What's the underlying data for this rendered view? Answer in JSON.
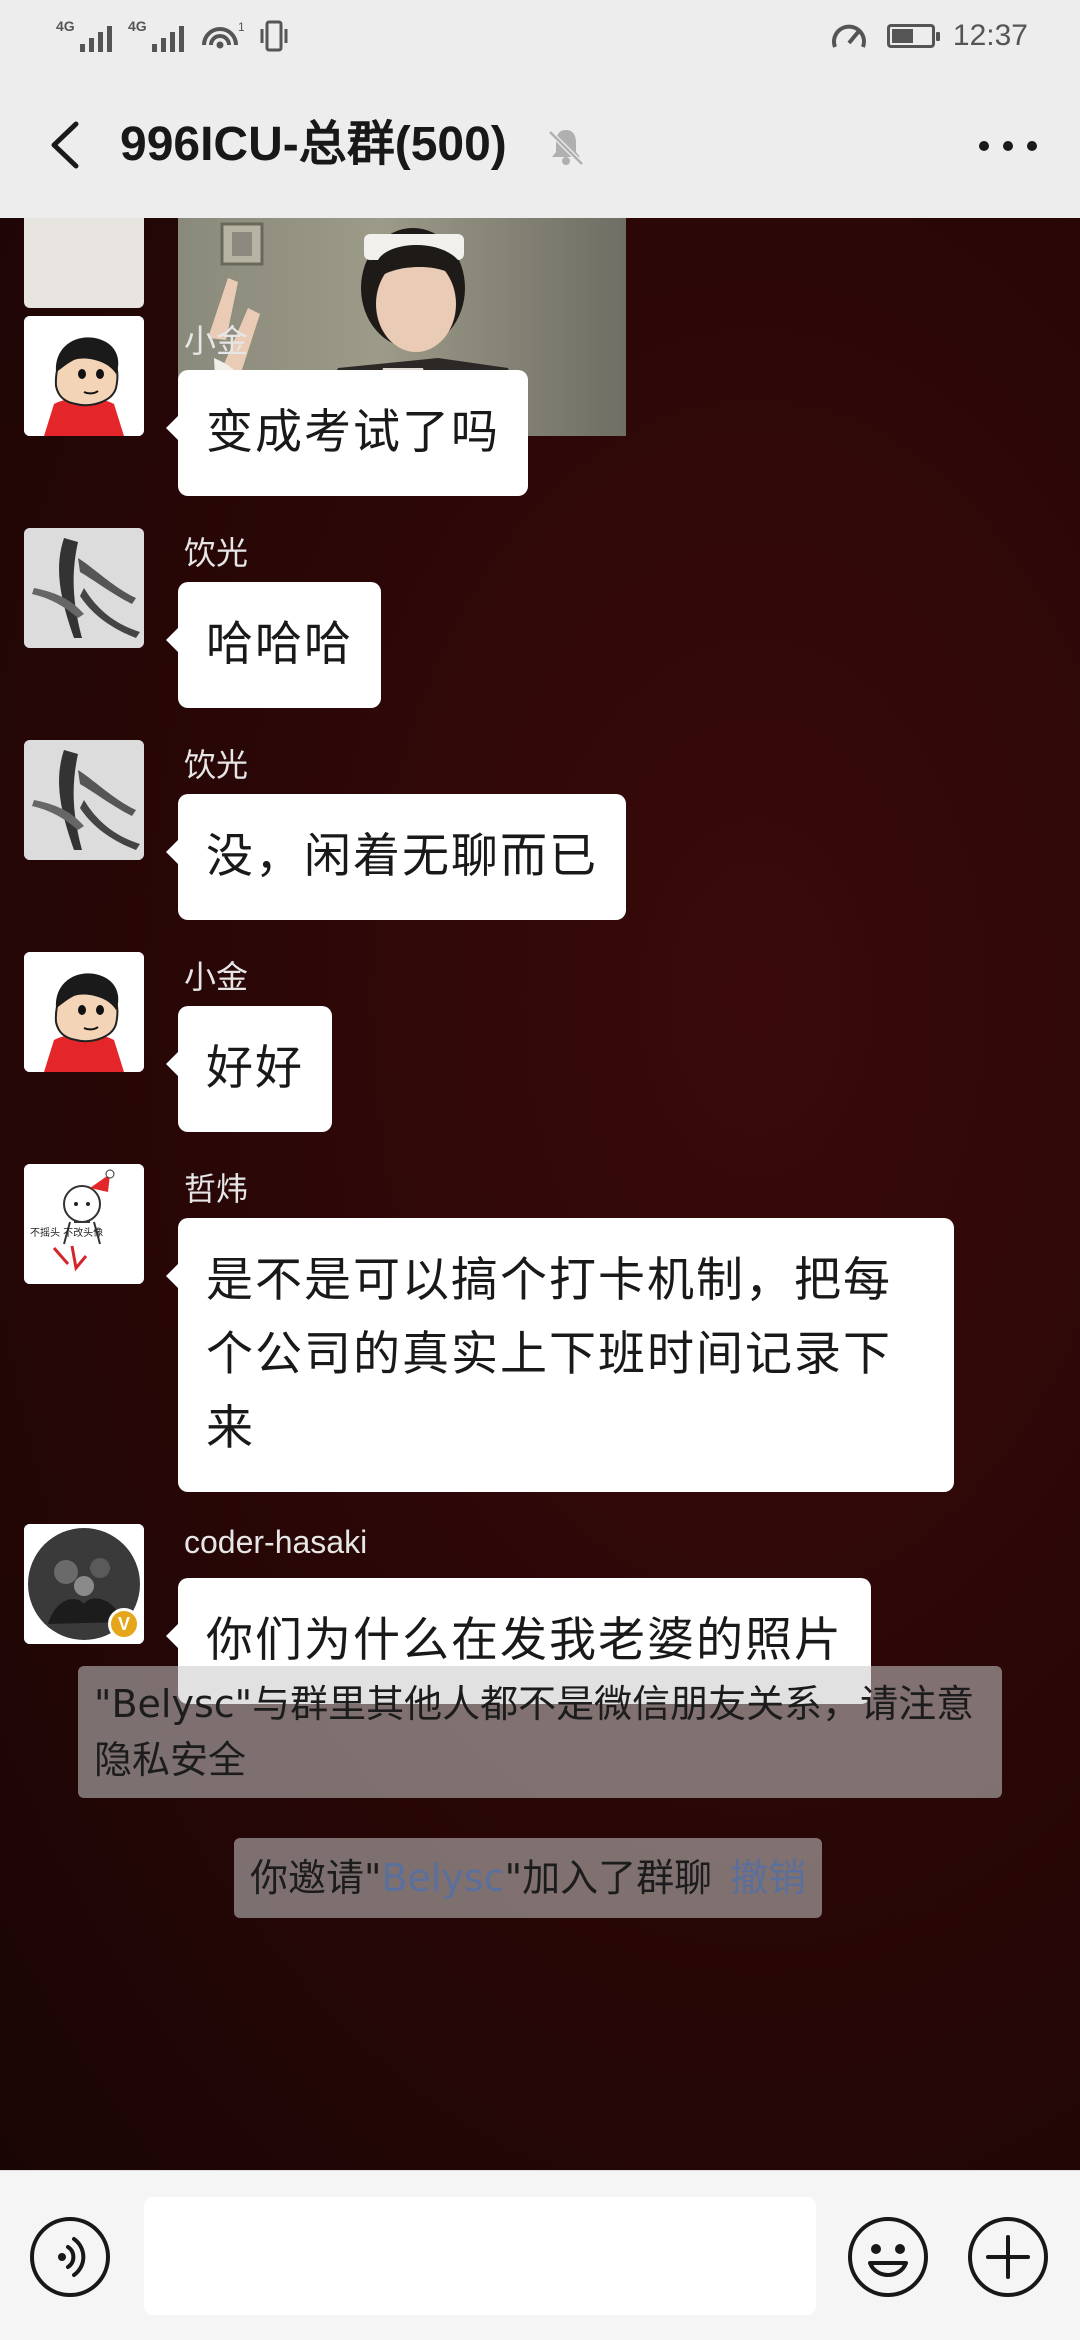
{
  "status_bar": {
    "net1": "4G",
    "net2": "4G",
    "hotspot": "1",
    "time": "12:37",
    "battery_level": 0.55
  },
  "header": {
    "title": "996ICU-总群(500)",
    "back_icon": "chevron-left-icon",
    "mute_icon": "bell-off-icon",
    "more_icon": "more-dots-icon"
  },
  "messages": [
    {
      "sender": "小金",
      "text": "变成考试了吗"
    },
    {
      "sender": "饮光",
      "text": "哈哈哈"
    },
    {
      "sender": "饮光",
      "text": "没，闲着无聊而已"
    },
    {
      "sender": "小金",
      "text": "好好"
    },
    {
      "sender": "哲炜",
      "text": "是不是可以搞个打卡机制，把每个公司的真实上下班时间记录下来",
      "avatar_text": "不摇头 不改头像"
    },
    {
      "sender": "coder-hasaki",
      "text": "你们为什么在发我老婆的照片",
      "badge": "V"
    }
  ],
  "system": {
    "notice": "\"Belysc\"与群里其他人都不是微信朋友关系，请注意隐私安全",
    "invite_prefix": "你邀请\"",
    "invite_name": "Belysc",
    "invite_suffix": "\"加入了群聊",
    "revoke": "撤销"
  },
  "input_bar": {
    "voice_icon": "voice-icon",
    "emoji_icon": "emoji-icon",
    "plus_icon": "plus-icon",
    "input_value": ""
  },
  "colors": {
    "bubble": "#ffffff",
    "chat_bg": "#2a0808",
    "link": "#5b6f9c",
    "bar": "#ededed"
  }
}
